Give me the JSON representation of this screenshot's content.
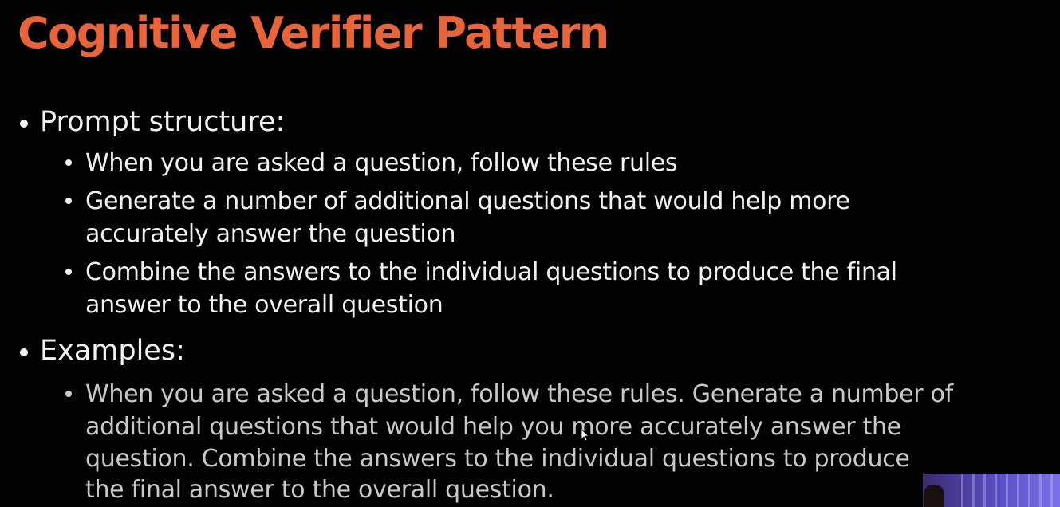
{
  "slide": {
    "title": "Cognitive Verifier Pattern",
    "title_color": "#e8643a",
    "sections": [
      {
        "heading": "Prompt structure:",
        "items": [
          {
            "lines": [
              "When you are asked a question, follow these rules"
            ]
          },
          {
            "lines": [
              "Generate a number of additional questions that would help more",
              "accurately answer the question"
            ]
          },
          {
            "lines": [
              "Combine the answers to the individual questions to produce the final",
              "answer to the overall question"
            ]
          }
        ]
      },
      {
        "heading": "Examples:",
        "items": [
          {
            "lines": [
              "When you are asked a question, follow these rules. Generate a number of",
              "additional questions that would help you more accurately answer the",
              "question. Combine the answers to the individual questions to produce",
              "the final answer to the overall question."
            ]
          }
        ]
      }
    ]
  },
  "icons": {
    "bullet": "filled-circle",
    "cursor": "mouse-pointer-icon",
    "webcam": "presenter-webcam-thumbnail"
  }
}
